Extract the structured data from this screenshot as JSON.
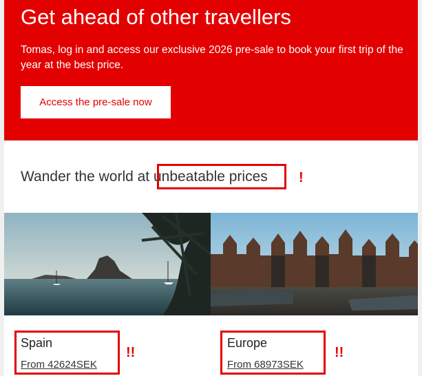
{
  "hero": {
    "title": "Get ahead of other travellers",
    "text": "Tomas, log in and access our exclusive 2026 pre-sale to book your first trip of the year at the best price.",
    "cta_label": "Access the pre-sale now"
  },
  "section": {
    "heading_prefix": "Wander the world at ",
    "heading_highlight": "unbeatable prices",
    "marker": "!"
  },
  "destinations": [
    {
      "name": "Spain",
      "price_link": "From 42624SEK",
      "marker": "!!"
    },
    {
      "name": "Europe",
      "price_link": "From 68973SEK",
      "marker": "!!"
    }
  ],
  "colors": {
    "brand_red": "#e30000",
    "annotation_red": "#e30000"
  }
}
